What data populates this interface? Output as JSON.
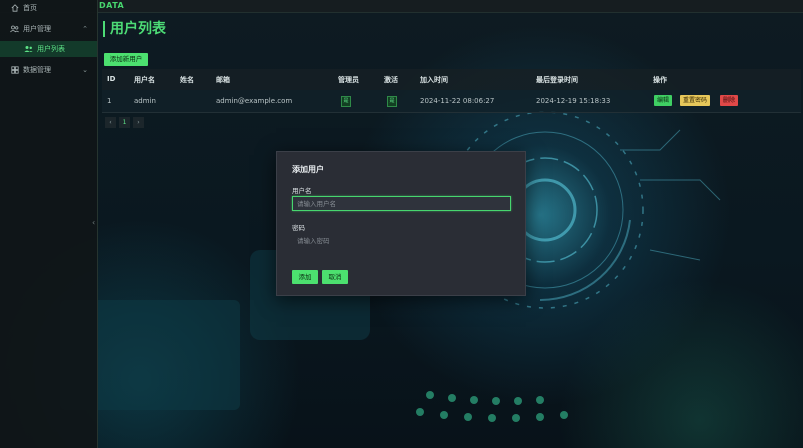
{
  "app": {
    "brand": "DATA"
  },
  "sidebar": {
    "items": [
      {
        "label": "首页",
        "icon": "home-icon"
      },
      {
        "label": "用户管理",
        "icon": "users-icon",
        "expanded": true
      },
      {
        "label": "用户列表",
        "icon": "user-list-icon",
        "active": true
      },
      {
        "label": "数据管理",
        "icon": "database-icon",
        "expanded": false
      }
    ]
  },
  "page": {
    "title": "用户列表",
    "add_button": "添加新用户"
  },
  "table": {
    "headers": [
      "ID",
      "用户名",
      "姓名",
      "邮箱",
      "管理员",
      "激活",
      "加入时间",
      "最后登录时间",
      "操作"
    ],
    "rows": [
      {
        "id": "1",
        "username": "admin",
        "name": "",
        "email": "admin@example.com",
        "admin_badge": "是",
        "active_badge": "是",
        "joined": "2024-11-22 08:06:27",
        "last_login": "2024-12-19 15:18:33",
        "actions": {
          "edit": "编辑",
          "reset": "重置密码",
          "delete": "删除"
        }
      }
    ]
  },
  "pagination": {
    "prev": "‹",
    "current": "1",
    "next": "›"
  },
  "modal": {
    "title": "添加用户",
    "username_label": "用户名",
    "username_placeholder": "请输入用户名",
    "password_label": "密码",
    "password_placeholder": "请输入密码",
    "submit": "添加",
    "cancel": "取消"
  },
  "colors": {
    "accent": "#4ddc76",
    "warning": "#e6c75a",
    "danger": "#e04848",
    "modal_bg": "#2a2d35"
  }
}
